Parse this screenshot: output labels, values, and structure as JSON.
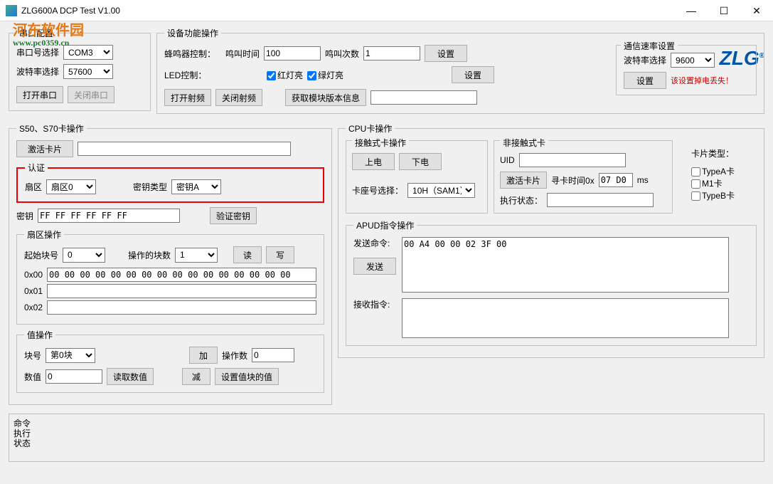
{
  "window": {
    "title": "ZLG600A DCP Test V1.00",
    "minimize": "—",
    "maximize": "☐",
    "close": "✕"
  },
  "watermark": {
    "line1": "河东软件园",
    "line2": "www.pc0359.cn"
  },
  "serial": {
    "legend": "串口配置",
    "port_label": "串口号选择",
    "port_value": "COM3",
    "baud_label": "波特率选择",
    "baud_value": "57600",
    "open_btn": "打开串口",
    "close_btn": "关闭串口"
  },
  "device": {
    "legend": "设备功能操作",
    "beep_label": "蜂鸣器控制：",
    "beep_time_label": "鸣叫时间",
    "beep_time_value": "100",
    "beep_count_label": "鸣叫次数",
    "beep_count_value": "1",
    "set_btn": "设置",
    "led_label": "LED控制：",
    "red_led": "红灯亮",
    "green_led": "绿灯亮",
    "rf_on": "打开射频",
    "rf_off": "关闭射频",
    "get_version": "获取模块版本信息",
    "version_value": ""
  },
  "baud": {
    "legend": "通信速率设置",
    "label": "波特率选择",
    "value": "9600",
    "set_btn": "设置",
    "warn": "该设置掉电丢失！"
  },
  "logo": "ZLG",
  "s50": {
    "legend": "S50、S70卡操作",
    "activate_btn": "激活卡片",
    "activate_value": "",
    "auth": {
      "legend": "认证",
      "sector_label": "扇区",
      "sector_value": "扇区0",
      "keytype_label": "密钥类型",
      "keytype_value": "密钥A"
    },
    "key_label": "密钥",
    "key_value": "FF FF FF FF FF FF",
    "verify_btn": "验证密钥",
    "sector_ops": {
      "legend": "扇区操作",
      "start_block_label": "起始块号",
      "start_block_value": "0",
      "block_count_label": "操作的块数",
      "block_count_value": "1",
      "read_btn": "读",
      "write_btn": "写",
      "r0_label": "0x00",
      "r0_value": "00 00 00 00 00 00 00 00 00 00 00 00 00 00 00 00",
      "r1_label": "0x01",
      "r1_value": "",
      "r2_label": "0x02",
      "r2_value": ""
    },
    "value_ops": {
      "legend": "值操作",
      "block_label": "块号",
      "block_value": "第0块",
      "value_label": "数值",
      "value_value": "0",
      "read_val_btn": "读取数值",
      "add_btn": "加",
      "sub_btn": "减",
      "op_count_label": "操作数",
      "op_count_value": "0",
      "set_val_btn": "设置值块的值"
    }
  },
  "cpu": {
    "legend": "CPU卡操作",
    "contact": {
      "legend": "接触式卡操作",
      "power_on": "上电",
      "power_off": "下电",
      "slot_label": "卡座号选择：",
      "slot_value": "10H（SAM1）"
    },
    "noncontact": {
      "legend": "非接触式卡",
      "uid_label": "UID",
      "uid_value": "",
      "activate_btn": "激活卡片",
      "seek_time_label": "寻卡时间0x",
      "seek_time_value": "07 D0",
      "ms": "ms",
      "status_label": "执行状态：",
      "status_value": ""
    },
    "card_type": {
      "legend": "卡片类型：",
      "typea": "TypeA卡",
      "m1": "M1卡",
      "typeb": "TypeB卡"
    },
    "apdu": {
      "legend": "APUD指令操作",
      "send_label": "发送命令:",
      "send_value": "00 A4 00 00 02 3F 00",
      "send_btn": "发送",
      "recv_label": "接收指令:",
      "recv_value": ""
    }
  },
  "status": {
    "label": "命令\n执行\n状态",
    "value": ""
  }
}
